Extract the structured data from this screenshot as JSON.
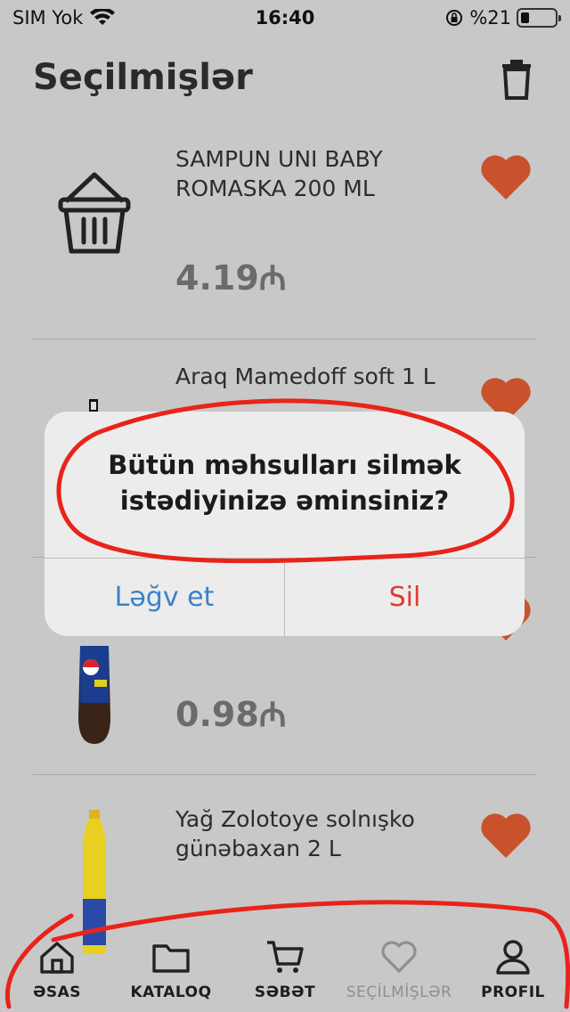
{
  "status_bar": {
    "carrier": "SIM Yok",
    "time": "16:40",
    "battery": "%21"
  },
  "header": {
    "title": "Seçilmişlər"
  },
  "products": [
    {
      "name": "SAMPUN UNI BABY ROMASKA 200 ML",
      "price": "4.19₼",
      "image": "basket-placeholder"
    },
    {
      "name": "Araq Mamedoff soft 1 L",
      "price": "",
      "image": "vodka-bottle"
    },
    {
      "name": "",
      "price": "0.98₼",
      "image": "pepsi-twist-bottle"
    },
    {
      "name": "Yağ Zolotoye solnışko günəbaxan 2 L",
      "price": "",
      "image": "sunflower-oil-bottle"
    }
  ],
  "alert": {
    "message": "Bütün məhsulları silmək istədiyinizə əminsiniz?",
    "cancel_label": "Ləğv et",
    "delete_label": "Sil"
  },
  "tabs": [
    {
      "label": "ƏSAS",
      "icon": "home-icon"
    },
    {
      "label": "KATALOQ",
      "icon": "folder-icon"
    },
    {
      "label": "SƏBƏT",
      "icon": "cart-icon"
    },
    {
      "label": "SEÇİLMİŞLƏR",
      "icon": "heart-icon",
      "active": true
    },
    {
      "label": "PROFIL",
      "icon": "user-icon"
    }
  ],
  "colors": {
    "background": "#c8c8c8",
    "heart": "#c9522c",
    "annotation": "#e8241a",
    "alert_cancel": "#3a82c8",
    "alert_destructive": "#de3b32"
  }
}
